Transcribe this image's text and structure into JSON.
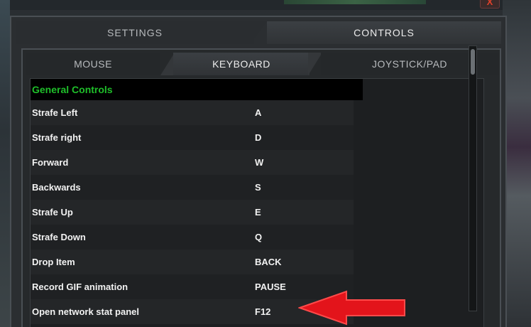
{
  "window": {
    "close_label": "X"
  },
  "top_tabs": [
    {
      "label": "SETTINGS",
      "active": false
    },
    {
      "label": "CONTROLS",
      "active": true
    }
  ],
  "sub_tabs": [
    {
      "label": "MOUSE",
      "active": false
    },
    {
      "label": "KEYBOARD",
      "active": true
    },
    {
      "label": "JOYSTICK/PAD",
      "active": false
    }
  ],
  "section": {
    "title": "General Controls",
    "title_color": "#1fbf2a"
  },
  "bindings": [
    {
      "action": "Strafe Left",
      "key": "A"
    },
    {
      "action": "Strafe right",
      "key": "D"
    },
    {
      "action": "Forward",
      "key": "W"
    },
    {
      "action": "Backwards",
      "key": "S"
    },
    {
      "action": "Strafe Up",
      "key": "E"
    },
    {
      "action": "Strafe Down",
      "key": "Q"
    },
    {
      "action": "Drop Item",
      "key": "BACK"
    },
    {
      "action": "Record GIF animation",
      "key": "PAUSE"
    },
    {
      "action": "Open network stat panel",
      "key": "F12"
    }
  ],
  "annotation": {
    "arrow_color": "#e3141b",
    "arrow_icon": "red-arrow-left-icon"
  }
}
